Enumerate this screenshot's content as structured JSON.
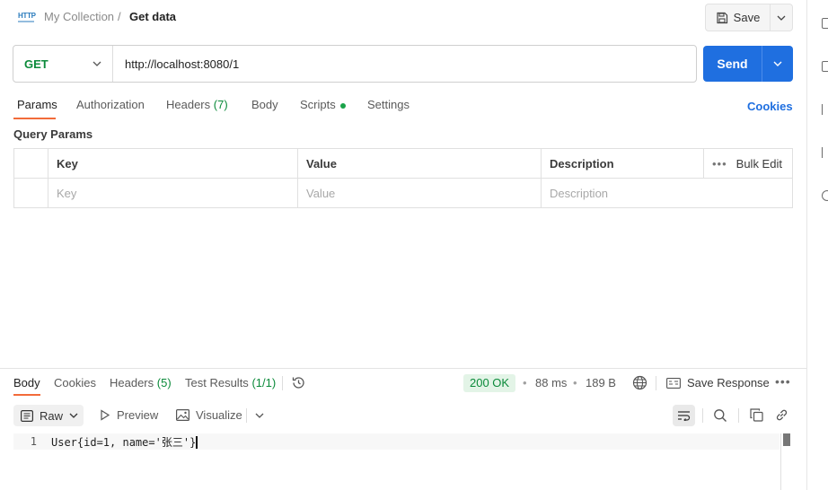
{
  "header": {
    "http_badge": "HTTP",
    "collection": "My Collection",
    "separator": "/",
    "request_name": "Get data",
    "save_label": "Save"
  },
  "request": {
    "method": "GET",
    "url": "http://localhost:8080/1",
    "send_label": "Send"
  },
  "request_tabs": {
    "params": "Params",
    "authorization": "Authorization",
    "headers": "Headers",
    "headers_count": "(7)",
    "body": "Body",
    "scripts": "Scripts",
    "settings": "Settings",
    "cookies": "Cookies"
  },
  "query_params": {
    "title": "Query Params",
    "columns": {
      "key": "Key",
      "value": "Value",
      "description": "Description",
      "bulk_edit": "Bulk Edit"
    },
    "placeholders": {
      "key": "Key",
      "value": "Value",
      "description": "Description"
    }
  },
  "response": {
    "tabs": {
      "body": "Body",
      "cookies": "Cookies",
      "headers": "Headers",
      "headers_count": "(5)",
      "test_results": "Test Results",
      "test_count": "(1/1)"
    },
    "status": "200 OK",
    "time": "88 ms",
    "size": "189 B",
    "save_response": "Save Response",
    "view_modes": {
      "raw": "Raw",
      "preview": "Preview",
      "visualize": "Visualize"
    },
    "line_number": "1",
    "body_text_start": "User",
    "body_text_mid": "{id=1, name='张三'",
    "body_text_end": "}"
  },
  "colors": {
    "accent_blue": "#1f6fe0",
    "method_green": "#0b8a3a",
    "tab_underline": "#f26b3a",
    "status_bg": "#e3f4e7"
  }
}
